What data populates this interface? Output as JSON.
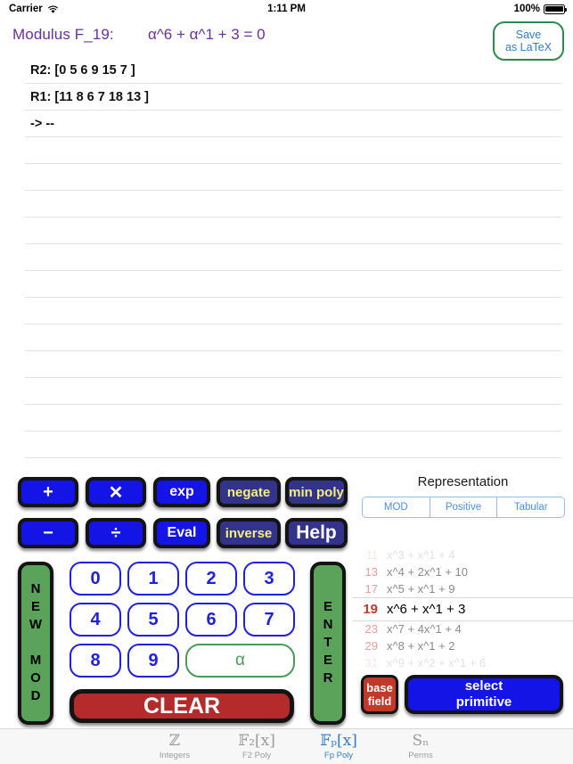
{
  "status_bar": {
    "carrier": "Carrier",
    "wifi_icon": "wifi-icon",
    "time": "1:11 PM",
    "battery_percent": "100%",
    "battery_icon": "battery-full-icon"
  },
  "header": {
    "modulus_label": "Modulus F_19:",
    "modulus_polynomial": "α^6 + α^1 + 3  = 0",
    "save_latex_line1": "Save",
    "save_latex_line2": "as LaTeX",
    "save_border_color": "#2e8b4f",
    "save_text_color": "#2f7fd1",
    "modulus_text_color": "#6b2f9e"
  },
  "worksheet": {
    "line_count": 15,
    "lines": [
      "R2: [0 5 6 9 15 7 ]",
      "R1: [11 8 6 7 18 13 ]",
      "-> --",
      "",
      "",
      "",
      "",
      "",
      "",
      "",
      "",
      "",
      "",
      "",
      ""
    ]
  },
  "keypad": {
    "op_row1": [
      {
        "label": "+",
        "style": "blue",
        "name": "add-button"
      },
      {
        "label": "✕",
        "style": "blue",
        "name": "multiply-button"
      },
      {
        "label": "exp",
        "style": "blue",
        "name": "exp-button"
      },
      {
        "label": "negate",
        "style": "navy",
        "name": "negate-button"
      },
      {
        "label": "min poly",
        "style": "navy",
        "name": "min-poly-button"
      }
    ],
    "op_row2": [
      {
        "label": "−",
        "style": "blue",
        "name": "subtract-button"
      },
      {
        "label": "÷",
        "style": "blue",
        "name": "divide-button"
      },
      {
        "label": "Eval",
        "style": "blue",
        "name": "eval-button"
      },
      {
        "label": "inverse",
        "style": "navy",
        "name": "inverse-button"
      },
      {
        "label": "Help",
        "style": "navy-white",
        "name": "help-button"
      }
    ],
    "new_mod_label": "NEW MOD",
    "enter_label": "ENTER",
    "digits": [
      "0",
      "1",
      "2",
      "3",
      "4",
      "5",
      "6",
      "7",
      "8",
      "9"
    ],
    "alpha_label": "α",
    "clear_label": "CLEAR",
    "colors": {
      "digit_blue": "#2020dd",
      "alpha_green": "#4a9a58",
      "key_green": "#5ba35b",
      "clear_red": "#b52a2a",
      "op_blue": "#1414e6",
      "op_navy": "#33338c",
      "op_yellow_text": "#f2f07a"
    }
  },
  "representation": {
    "title": "Representation",
    "options": [
      "MOD",
      "Positive",
      "Tabular"
    ],
    "selected": "MOD"
  },
  "primitive_picker": {
    "rows": [
      {
        "num": "11",
        "poly": "x^3 + x^1 + 4",
        "state": "faded-top"
      },
      {
        "num": "13",
        "poly": "x^4 + 2x^1 + 10",
        "state": "dim"
      },
      {
        "num": "17",
        "poly": "x^5 + x^1 + 9",
        "state": "dim"
      },
      {
        "num": "19",
        "poly": "x^6 + x^1 + 3",
        "state": "selected"
      },
      {
        "num": "23",
        "poly": "x^7 + 4x^1 + 4",
        "state": "dim"
      },
      {
        "num": "29",
        "poly": "x^8 + x^1 + 2",
        "state": "dim"
      },
      {
        "num": "31",
        "poly": "x^9 + x^2 + x^1 + 6",
        "state": "faded-bottom"
      }
    ],
    "selected_index": 3
  },
  "right_buttons": {
    "base_field_line1": "base",
    "base_field_line2": "field",
    "select_primitive_line1": "select",
    "select_primitive_line2": "primitive",
    "base_field_color": "#c0392b",
    "select_primitive_color": "#1414e6"
  },
  "tab_bar": {
    "tabs": [
      {
        "icon": "ℤ",
        "label": "Integers",
        "name": "tab-integers",
        "active": false
      },
      {
        "icon": "𝔽₂[x]",
        "label": "F2 Poly",
        "name": "tab-f2-poly",
        "active": false
      },
      {
        "icon": "𝔽ₚ[x]",
        "label": "Fp Poly",
        "name": "tab-fp-poly",
        "active": true
      },
      {
        "icon": "Sₙ",
        "label": "Perms",
        "name": "tab-perms",
        "active": false
      }
    ],
    "active_color": "#2f7fd1",
    "inactive_color": "#9b9b9b"
  }
}
